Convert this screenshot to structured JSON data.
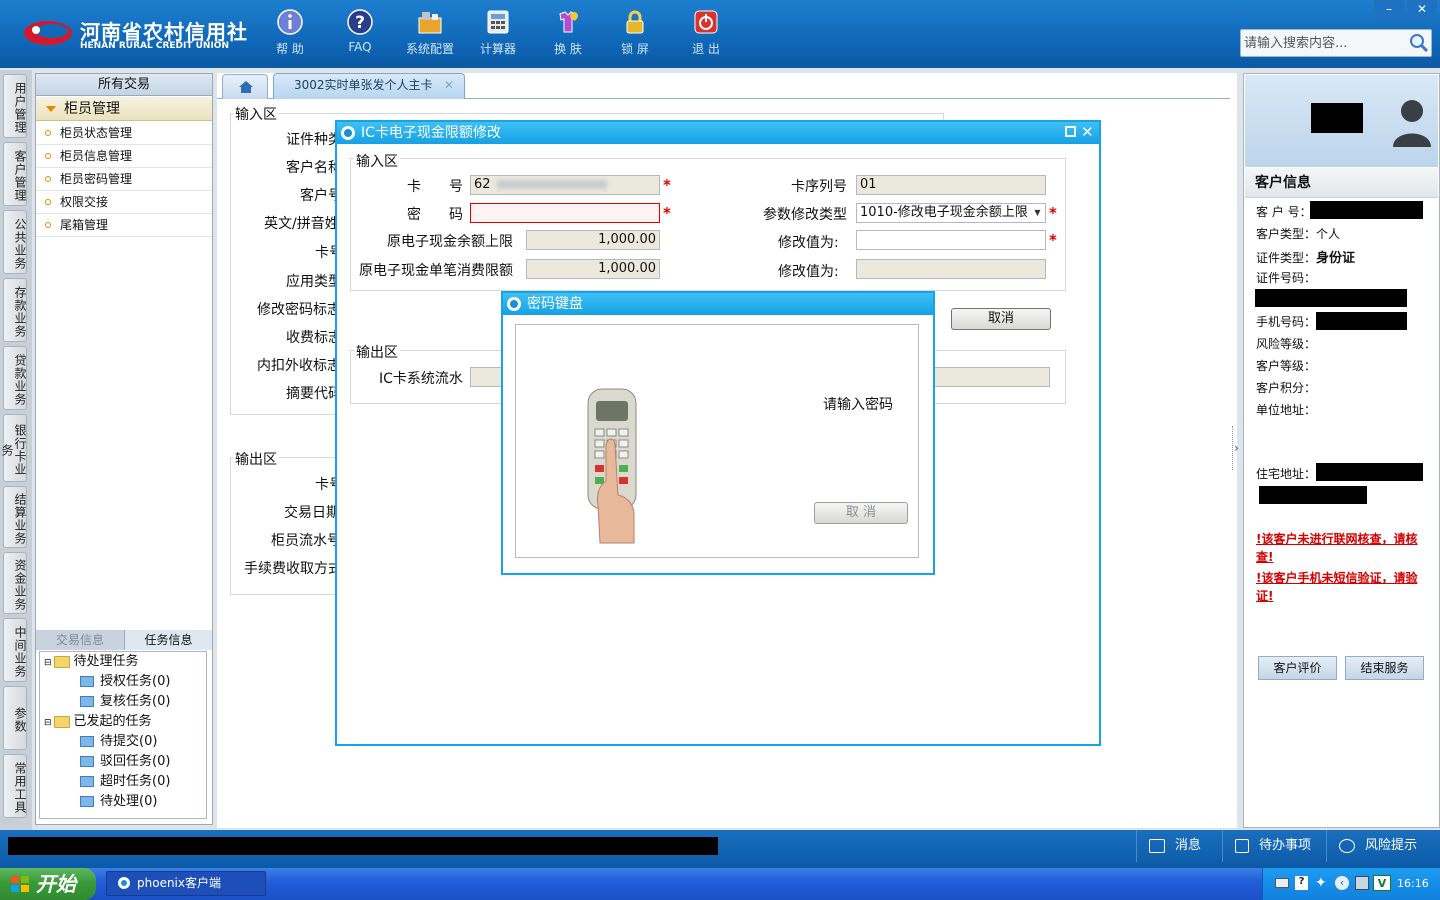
{
  "header": {
    "logo_cn": "河南省农村信用社",
    "logo_en": "HENAN RURAL CREDIT UNION",
    "toolbar": [
      {
        "label": "帮 助",
        "icon": "info-icon"
      },
      {
        "label": "FAQ",
        "icon": "question-icon"
      },
      {
        "label": "系统配置",
        "icon": "config-icon"
      },
      {
        "label": "计算器",
        "icon": "calculator-icon"
      },
      {
        "label": "换 肤",
        "icon": "skin-icon"
      },
      {
        "label": "锁 屏",
        "icon": "lock-icon"
      },
      {
        "label": "退 出",
        "icon": "power-icon"
      }
    ],
    "search_placeholder": "请输入搜索内容..."
  },
  "vtabs": [
    "用户管理",
    "客户管理",
    "公共业务",
    "存款业务",
    "贷款业务",
    "银行卡业务",
    "结算业务",
    "资金业务",
    "中间业务",
    "参数",
    "常用工具"
  ],
  "leftmenu": {
    "title": "所有交易",
    "group": "柜员管理",
    "items": [
      "柜员状态管理",
      "柜员信息管理",
      "柜员密码管理",
      "权限交接",
      "尾箱管理"
    ],
    "tabs": [
      "交易信息",
      "任务信息"
    ],
    "tree": {
      "pending": "待处理任务",
      "authorize": "授权任务(0)",
      "review": "复核任务(0)",
      "initiated": "已发起的任务",
      "to_submit": "待提交(0)",
      "rejected": "驳回任务(0)",
      "timeout": "超时任务(0)",
      "to_process": "待处理(0)"
    }
  },
  "tabs": {
    "active": "3002实时单张发个人主卡"
  },
  "form_bg": {
    "input_area": "输入区",
    "output_area": "输出区",
    "input_fields": [
      "证件种类",
      "客户名称",
      "客户号",
      "英文/拼音姓",
      "卡号",
      "应用类型",
      "修改密码标志",
      "收费标志",
      "内扣外收标志",
      "摘要代码"
    ],
    "output_fields": [
      "卡号",
      "交易日期",
      "柜员流水号",
      "手续费收取方式"
    ]
  },
  "dialog_ic": {
    "title": "IC卡电子现金限额修改",
    "input_area": "输入区",
    "output_area": "输出区",
    "card_no_label": "卡　　号",
    "card_no_value": "62",
    "password_label": "密　　码",
    "orig_balance_limit_label": "原电子现金余额上限",
    "orig_balance_limit_value": "1,000.00",
    "orig_single_limit_label": "原电子现金单笔消费限额",
    "orig_single_limit_value": "1,000.00",
    "card_seq_label": "卡序列号",
    "card_seq_value": "01",
    "param_type_label": "参数修改类型",
    "param_type_value": "1010-修改电子现金余额上限",
    "modify_value_label_1": "修改值为:",
    "modify_value_label_2": "修改值为:",
    "cancel_button": "取消",
    "ic_serial_label": "IC卡系统流水"
  },
  "dialog_pwd": {
    "title": "密码键盘",
    "prompt": "请输入密码",
    "cancel_button": "取 消"
  },
  "customer": {
    "header": "客户信息",
    "cust_no_label": "客 户 号：",
    "cust_type_label": "客户类型：",
    "cust_type_value": "个人",
    "id_type_label": "证件类型：",
    "id_type_value": "身份证",
    "id_no_label": "证件号码：",
    "phone_label": "手机号码：",
    "risk_label": "风险等级：",
    "level_label": "客户等级：",
    "points_label": "客户积分：",
    "work_addr_label": "单位地址：",
    "home_addr_label": "住宅地址：",
    "warning1": "!该客户未进行联网核查，请核查!",
    "warning2": "!该客户手机未短信验证，请验证!",
    "rate_button": "客户评价",
    "end_button": "结束服务"
  },
  "statusbar": {
    "messages": "消息",
    "todo": "待办事项",
    "risk": "风险提示"
  },
  "taskbar": {
    "start": "开始",
    "task": "phoenix客户端",
    "time": "16:16"
  }
}
